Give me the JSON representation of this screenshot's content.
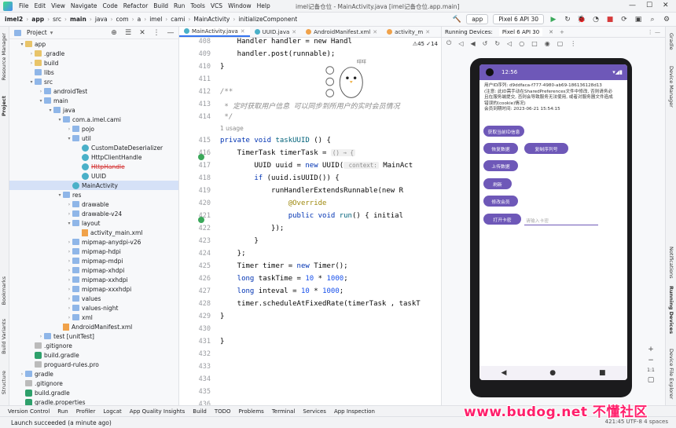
{
  "menu": {
    "items": [
      "File",
      "Edit",
      "View",
      "Navigate",
      "Code",
      "Refactor",
      "Build",
      "Run",
      "Tools",
      "VCS",
      "Window",
      "Help"
    ],
    "window_title": "imel记备仓位 - MainActivity.java [imel记备仓位.app.main]"
  },
  "breadcrumb": [
    "imel2",
    "app",
    "src",
    "main",
    "java",
    "com",
    "a",
    "imel",
    "cami",
    "MainActivity",
    "initializeComponent"
  ],
  "toolbar": {
    "run_config": "app",
    "device": "Pixel 6 API 30"
  },
  "project": {
    "title": "Project",
    "tree": [
      {
        "label": "app",
        "indent": 1,
        "type": "folder-y",
        "arrow": "▾",
        "sel": false
      },
      {
        "label": ".gradle",
        "indent": 2,
        "type": "folder-y",
        "arrow": "›",
        "sel": false
      },
      {
        "label": "build",
        "indent": 2,
        "type": "folder-y",
        "arrow": "›",
        "sel": false
      },
      {
        "label": "libs",
        "indent": 2,
        "type": "folder",
        "arrow": "",
        "sel": false
      },
      {
        "label": "src",
        "indent": 2,
        "type": "folder",
        "arrow": "▾",
        "sel": false
      },
      {
        "label": "androidTest",
        "indent": 3,
        "type": "folder",
        "arrow": "›",
        "sel": false
      },
      {
        "label": "main",
        "indent": 3,
        "type": "folder",
        "arrow": "▾",
        "sel": false
      },
      {
        "label": "java",
        "indent": 4,
        "type": "folder",
        "arrow": "▾",
        "sel": false
      },
      {
        "label": "com.a.imel.cami",
        "indent": 5,
        "type": "folder",
        "arrow": "▾",
        "sel": false
      },
      {
        "label": "pojo",
        "indent": 6,
        "type": "folder",
        "arrow": "›",
        "sel": false
      },
      {
        "label": "util",
        "indent": 6,
        "type": "folder",
        "arrow": "▾",
        "sel": false
      },
      {
        "label": "CustomDateDeserializer",
        "indent": 7,
        "type": "java",
        "arrow": "",
        "sel": false
      },
      {
        "label": "HttpClientHandle",
        "indent": 7,
        "type": "java",
        "arrow": "",
        "sel": false
      },
      {
        "label": "HttpHandle",
        "indent": 7,
        "type": "java-strike",
        "arrow": "",
        "sel": false
      },
      {
        "label": "UUID",
        "indent": 7,
        "type": "java",
        "arrow": "",
        "sel": false
      },
      {
        "label": "MainActivity",
        "indent": 6,
        "type": "java",
        "arrow": "",
        "sel": true
      },
      {
        "label": "res",
        "indent": 5,
        "type": "folder",
        "arrow": "▾",
        "sel": false
      },
      {
        "label": "drawable",
        "indent": 6,
        "type": "folder",
        "arrow": "›",
        "sel": false
      },
      {
        "label": "drawable-v24",
        "indent": 6,
        "type": "folder",
        "arrow": "›",
        "sel": false
      },
      {
        "label": "layout",
        "indent": 6,
        "type": "folder",
        "arrow": "▾",
        "sel": false
      },
      {
        "label": "activity_main.xml",
        "indent": 7,
        "type": "xml",
        "arrow": "",
        "sel": false
      },
      {
        "label": "mipmap-anydpi-v26",
        "indent": 6,
        "type": "folder",
        "arrow": "›",
        "sel": false
      },
      {
        "label": "mipmap-hdpi",
        "indent": 6,
        "type": "folder",
        "arrow": "›",
        "sel": false
      },
      {
        "label": "mipmap-mdpi",
        "indent": 6,
        "type": "folder",
        "arrow": "›",
        "sel": false
      },
      {
        "label": "mipmap-xhdpi",
        "indent": 6,
        "type": "folder",
        "arrow": "›",
        "sel": false
      },
      {
        "label": "mipmap-xxhdpi",
        "indent": 6,
        "type": "folder",
        "arrow": "›",
        "sel": false
      },
      {
        "label": "mipmap-xxxhdpi",
        "indent": 6,
        "type": "folder",
        "arrow": "›",
        "sel": false
      },
      {
        "label": "values",
        "indent": 6,
        "type": "folder",
        "arrow": "›",
        "sel": false
      },
      {
        "label": "values-night",
        "indent": 6,
        "type": "folder",
        "arrow": "›",
        "sel": false
      },
      {
        "label": "xml",
        "indent": 6,
        "type": "folder",
        "arrow": "›",
        "sel": false
      },
      {
        "label": "AndroidManifest.xml",
        "indent": 5,
        "type": "xml",
        "arrow": "",
        "sel": false
      },
      {
        "label": "test [unitTest]",
        "indent": 3,
        "type": "folder",
        "arrow": "›",
        "sel": false
      },
      {
        "label": ".gitignore",
        "indent": 2,
        "type": "file",
        "arrow": "",
        "sel": false
      },
      {
        "label": "build.gradle",
        "indent": 2,
        "type": "gradle",
        "arrow": "",
        "sel": false
      },
      {
        "label": "proguard-rules.pro",
        "indent": 2,
        "type": "file",
        "arrow": "",
        "sel": false
      },
      {
        "label": "gradle",
        "indent": 1,
        "type": "folder",
        "arrow": "›",
        "sel": false
      },
      {
        "label": ".gitignore",
        "indent": 1,
        "type": "file",
        "arrow": "",
        "sel": false
      },
      {
        "label": "build.gradle",
        "indent": 1,
        "type": "gradle",
        "arrow": "",
        "sel": false
      },
      {
        "label": "gradle.properties",
        "indent": 1,
        "type": "gradle",
        "arrow": "",
        "sel": false
      }
    ]
  },
  "editor": {
    "tabs": [
      {
        "label": "MainActivity.java",
        "active": true,
        "color": "#4ab0c8"
      },
      {
        "label": "UUID.java",
        "active": false,
        "color": "#4ab0c8"
      },
      {
        "label": "AndroidManifest.xml",
        "active": false,
        "color": "#f0a24a"
      },
      {
        "label": "activity_m",
        "active": false,
        "color": "#f0a24a"
      }
    ],
    "warnings": "⚠45  ✓14",
    "lines": [
      "408",
      "409",
      "410",
      "411",
      "412",
      "413",
      "414",
      "",
      "415",
      "416",
      "417",
      "418",
      "419",
      "420",
      "421",
      "422",
      "423",
      "424",
      "425",
      "426",
      "427",
      "428",
      "429",
      "430",
      "431",
      "432",
      "433",
      "434",
      "435",
      "436"
    ],
    "bird_caption": "咩咩"
  },
  "code": {
    "l408": "    Handler handler = new Handl",
    "l409": "    handler.post(runnable);",
    "l410": "}",
    "l412": "/**",
    "l413": " * 定时获取用户信息 可以同步到所用户的实时会员情况",
    "l414": " */",
    "usage": "1 usage",
    "l415a": "private void ",
    "l415b": "taskUUID",
    "l415c": " () {",
    "l416a": "    TimerTask timerTask = ",
    "l416b": "() → {",
    "l417a": "        UUID uuid = ",
    "l417b": "new",
    "l417c": " UUID(",
    "l417d": " context:",
    "l417e": " MainAct",
    "l418a": "        if",
    "l418b": " (uuid.isUUID()) {",
    "l419": "            runHandlerExtendsRunnable(new R",
    "l420": "                @Override",
    "l421a": "                public void ",
    "l421b": "run",
    "l421c": "() { initial",
    "l422": "            });",
    "l423": "        }",
    "l424": "    };",
    "l425a": "    Timer timer = ",
    "l425b": "new",
    "l425c": " Timer();",
    "l426a": "    long",
    "l426b": " taskTime = ",
    "l426c": "10",
    "l426d": " * ",
    "l426e": "1000",
    "l426f": ";",
    "l427a": "    long",
    "l427b": " inteval = ",
    "l427c": "10",
    "l427d": " * ",
    "l427e": "1000",
    "l427f": ";",
    "l428": "    timer.scheduleAtFixedRate(timerTask , taskT",
    "l429": "}",
    "l431": "}"
  },
  "running": {
    "title": "Running Devices:",
    "device_tab": "Pixel 6 API 30"
  },
  "phone": {
    "time": "12:56",
    "text": [
      "用户ID序列: d9ddfaca-f777-4980-ab69-186136128d13",
      "(注意: 此ID需手动在SharedPreferences文件中修改, 否则请务必",
      "且在服务端提交, 否则会导致服务无法使用, 或者对服务器文件造成",
      "错误的(cookie)情况)",
      "会员到期时间: 2023-06-21 15:54:15"
    ],
    "buttons": [
      "获取当前ID信息",
      "恢复数据",
      "复制序列号",
      "上传数据",
      "刷新",
      "修改会员",
      "打开卡密"
    ],
    "input_placeholder": "请输入卡密"
  },
  "right_panel": [
    "Gradle",
    "Device Manager",
    "Notifications",
    "Running Devices",
    "Device File Explorer"
  ],
  "left_panel": [
    "Resource Manager",
    "Project",
    "Bookmarks",
    "Build Variants",
    "Structure"
  ],
  "bottom": {
    "tools": [
      "Version Control",
      "Run",
      "Profiler",
      "Logcat",
      "App Quality Insights",
      "Build",
      "TODO",
      "Problems",
      "Terminal",
      "Services",
      "App Inspection"
    ],
    "status": "Launch succeeded (a minute ago)",
    "right_status": "421:45  UTF-8  4 spaces"
  },
  "watermark": "www.budog.net 不懂社区"
}
